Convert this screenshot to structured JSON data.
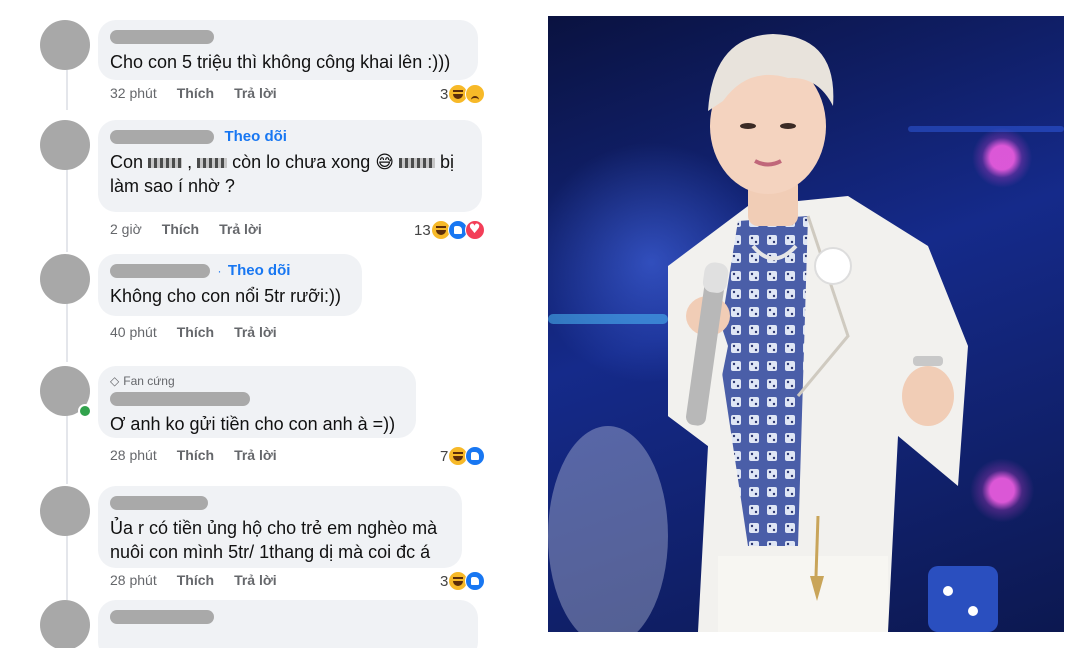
{
  "comments": [
    {
      "text": "Cho con 5 triệu thì không công khai lên :)))",
      "time": "32 phút",
      "like": "Thích",
      "reply": "Trả lời",
      "reaction_count": "3"
    },
    {
      "follow": "Theo dõi",
      "text_a": "Con",
      "text_b": ",",
      "text_c": "còn lo chưa xong 😅",
      "text_d": "bị",
      "text_line2": "làm sao í nhờ ?",
      "time": "2 giờ",
      "like": "Thích",
      "reply": "Trả lời",
      "reaction_count": "13"
    },
    {
      "follow": "Theo dõi",
      "text": "Không cho con nổi 5tr rưỡi:))",
      "time": "40 phút",
      "like": "Thích",
      "reply": "Trả lời"
    },
    {
      "badge": "Fan cứng",
      "text": "Ơ anh ko gửi tiền cho con anh à =))",
      "time": "28 phút",
      "like": "Thích",
      "reply": "Trả lời",
      "reaction_count": "7"
    },
    {
      "text_line1": "Ủa r có tiền ủng hộ cho trẻ em nghèo mà",
      "text_line2": "nuôi con mình 5tr/ 1thang dị mà coi đc á",
      "time": "28 phút",
      "like": "Thích",
      "reply": "Trả lời",
      "reaction_count": "3"
    }
  ],
  "colors": {
    "link": "#1877f2",
    "bubble": "#f0f2f5",
    "meta": "#65676b"
  }
}
